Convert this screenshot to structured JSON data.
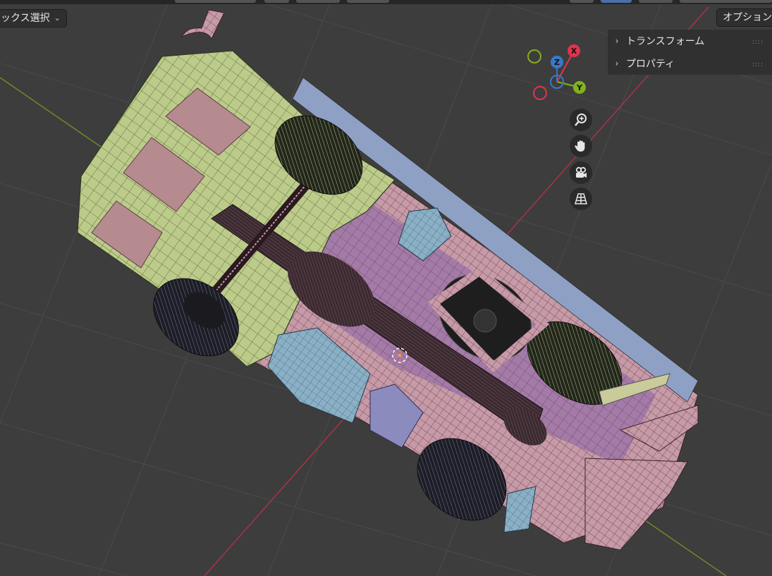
{
  "toolbar": {
    "select_label": "ックス選択",
    "options_label": "オプション"
  },
  "sidebar_panel": {
    "items": [
      {
        "label": "トランスフォーム"
      },
      {
        "label": "プロパティ"
      }
    ]
  },
  "gizmo": {
    "x_label": "X",
    "y_label": "Y",
    "z_label": "Z",
    "colors": {
      "x": "#e0344f",
      "y": "#82b11e",
      "z": "#3a77c8"
    }
  },
  "view_tools": [
    {
      "name": "zoom",
      "icon": "zoom-icon"
    },
    {
      "name": "pan",
      "icon": "hand-icon"
    },
    {
      "name": "camera",
      "icon": "camera-icon"
    },
    {
      "name": "perspective",
      "icon": "grid-perspective-icon"
    }
  ],
  "scene": {
    "object": "vehicle-chassis-wireframe",
    "axis_colors": {
      "x_axis": "#b03246",
      "y_axis": "#6f8f24"
    }
  }
}
